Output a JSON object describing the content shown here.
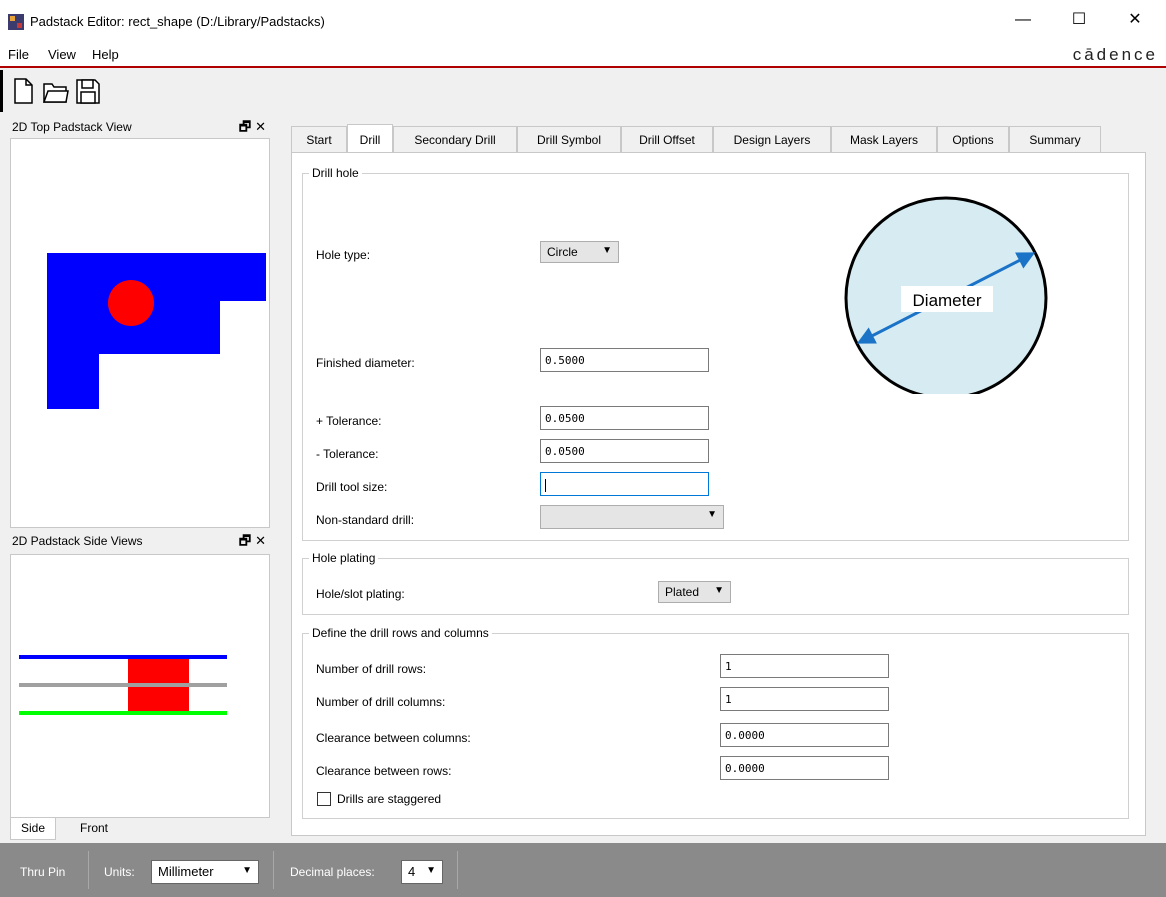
{
  "window": {
    "title": "Padstack Editor: rect_shape  (D:/Library/Padstacks)",
    "minimize": "—",
    "maximize": "☐",
    "close": "✕"
  },
  "menu": {
    "file": "File",
    "view": "View",
    "help": "Help",
    "brand": "cādence"
  },
  "panels": {
    "top_view_title": "2D Top Padstack View",
    "side_views_title": "2D Padstack Side Views",
    "panel_controls": "🗗✕",
    "side_tabs": [
      "Side",
      "Front"
    ]
  },
  "tabs": [
    "Start",
    "Drill",
    "Secondary Drill",
    "Drill Symbol",
    "Drill Offset",
    "Design Layers",
    "Mask Layers",
    "Options",
    "Summary"
  ],
  "drill_hole": {
    "group_title": "Drill hole",
    "hole_type_label": "Hole type:",
    "hole_type_value": "Circle",
    "finished_diameter_label": "Finished diameter:",
    "finished_diameter_value": "0.5000",
    "plus_tol_label": "+ Tolerance:",
    "plus_tol_value": "0.0500",
    "minus_tol_label": "- Tolerance:",
    "minus_tol_value": "0.0500",
    "tool_size_label": "Drill tool size:",
    "tool_size_value": "",
    "nonstd_label": "Non-standard drill:",
    "nonstd_value": "",
    "diagram_label": "Diameter"
  },
  "hole_plating": {
    "group_title": "Hole plating",
    "label": "Hole/slot plating:",
    "value": "Plated"
  },
  "rows_cols": {
    "group_title": "Define the drill rows and columns",
    "rows_label": "Number of drill rows:",
    "rows_value": "1",
    "cols_label": "Number of drill columns:",
    "cols_value": "1",
    "clear_cols_label": "Clearance between columns:",
    "clear_cols_value": "0.0000",
    "clear_rows_label": "Clearance between rows:",
    "clear_rows_value": "0.0000",
    "staggered_label": "Drills are staggered"
  },
  "status": {
    "type": "Thru Pin",
    "units_label": "Units:",
    "units_value": "Millimeter",
    "decimal_label": "Decimal places:",
    "decimal_value": "4"
  },
  "colors": {
    "pad": "#0000ff",
    "hole": "#ff0000",
    "top_layer": "#0000ff",
    "inner_layer": "#a0a0a0",
    "bottom_layer": "#00ff00",
    "diagram_fill": "#d6ebf2",
    "diagram_arrow": "#1a73c7"
  }
}
